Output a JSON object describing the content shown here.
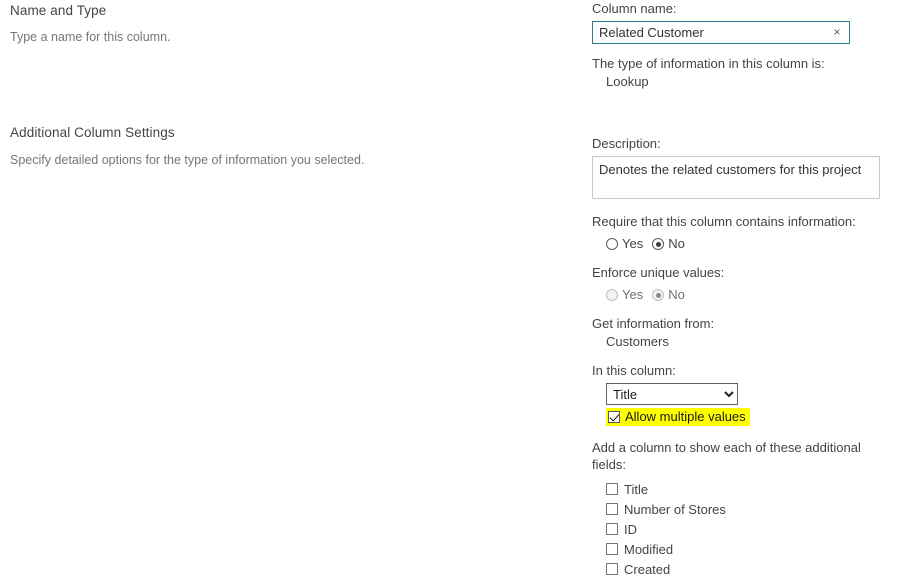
{
  "left": {
    "sections": [
      {
        "heading": "Name and Type",
        "description": "Type a name for this column."
      },
      {
        "heading": "Additional Column Settings",
        "description": "Specify detailed options for the type of information you selected."
      }
    ]
  },
  "form": {
    "column_name": {
      "label": "Column name:",
      "value": "Related Customer",
      "clear_icon": "×"
    },
    "type_info": {
      "label": "The type of information in this column is:",
      "value": "Lookup"
    },
    "description": {
      "label": "Description:",
      "value": "Denotes the related customers for this project"
    },
    "require_info": {
      "label": "Require that this column contains information:",
      "options": [
        "Yes",
        "No"
      ],
      "selected": "No"
    },
    "enforce_unique": {
      "label": "Enforce unique values:",
      "options": [
        "Yes",
        "No"
      ],
      "selected": "No",
      "disabled": true
    },
    "get_info_from": {
      "label": "Get information from:",
      "value": "Customers"
    },
    "in_this_column": {
      "label": "In this column:",
      "selected": "Title",
      "options": [
        "Title",
        "Number of Stores",
        "ID",
        "Modified",
        "Created"
      ]
    },
    "allow_multiple": {
      "label": "Allow multiple values",
      "checked": true,
      "highlight_color": "#ffff00"
    },
    "additional_fields": {
      "label": "Add a column to show each of these additional fields:",
      "items": [
        {
          "label": "Title",
          "checked": false
        },
        {
          "label": "Number of Stores",
          "checked": false
        },
        {
          "label": "ID",
          "checked": false
        },
        {
          "label": "Modified",
          "checked": false
        },
        {
          "label": "Created",
          "checked": false
        }
      ]
    }
  }
}
